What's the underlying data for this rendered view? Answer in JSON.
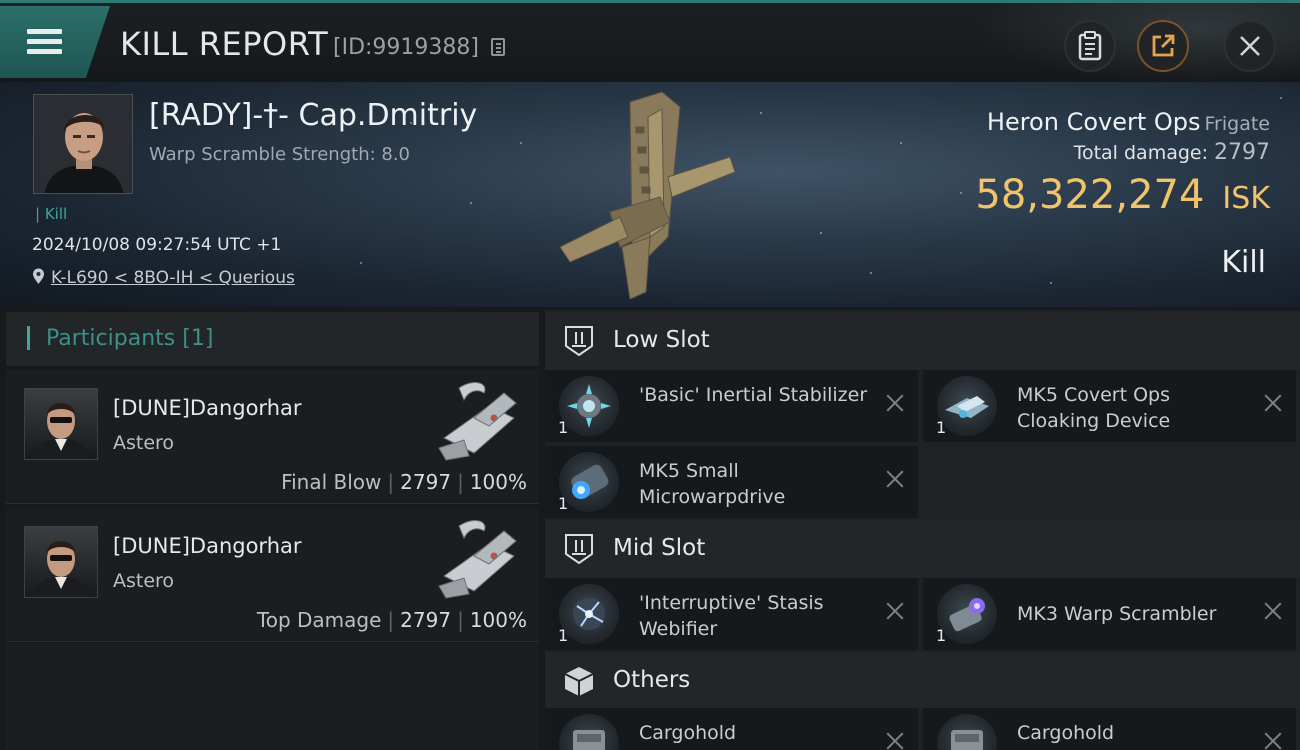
{
  "header": {
    "title": "KILL REPORT",
    "report_id": "[ID:9919388]",
    "icons": [
      "menu-icon",
      "copy-icon",
      "clipboard-icon",
      "share-icon",
      "close-icon"
    ]
  },
  "victim": {
    "name": "[RADY]-†- Cap.Dmitriy",
    "warp_scramble": "Warp Scramble Strength: 8.0",
    "tag": "Kill",
    "datetime": "2024/10/08 09:27:54 UTC +1",
    "location": "K-L690 < 8BO-IH < Querious",
    "ship_name": "Heron Covert Ops",
    "ship_class": "Frigate",
    "total_damage_label": "Total damage:",
    "total_damage": "2797",
    "isk_value": "58,322,274",
    "isk_unit": "ISK",
    "result": "Kill"
  },
  "participants": {
    "title": "Participants",
    "count": "[1]",
    "list": [
      {
        "name": "[DUNE]Dangorhar",
        "ship": "Astero",
        "role": "Final Blow",
        "damage": "2797",
        "percent": "100%"
      },
      {
        "name": "[DUNE]Dangorhar",
        "ship": "Astero",
        "role": "Top Damage",
        "damage": "2797",
        "percent": "100%"
      }
    ]
  },
  "slots": {
    "low": {
      "title": "Low Slot",
      "items": [
        {
          "name": "'Basic' Inertial Stabilizer",
          "qty": "1"
        },
        {
          "name": "MK5 Covert Ops Cloaking Device",
          "qty": "1"
        },
        {
          "name": "MK5 Small Microwarpdrive",
          "qty": "1"
        }
      ]
    },
    "mid": {
      "title": "Mid Slot",
      "items": [
        {
          "name": "'Interruptive' Stasis Webifier",
          "qty": "1"
        },
        {
          "name": "MK3 Warp Scrambler",
          "qty": "1"
        }
      ]
    },
    "others": {
      "title": "Others",
      "items": [
        {
          "name": "Cargohold"
        },
        {
          "name": "Cargohold"
        }
      ]
    }
  },
  "colors": {
    "accent_teal": "#3fa597",
    "isk_gold": "#f2c46a",
    "header_green": "#2b6f6a"
  }
}
